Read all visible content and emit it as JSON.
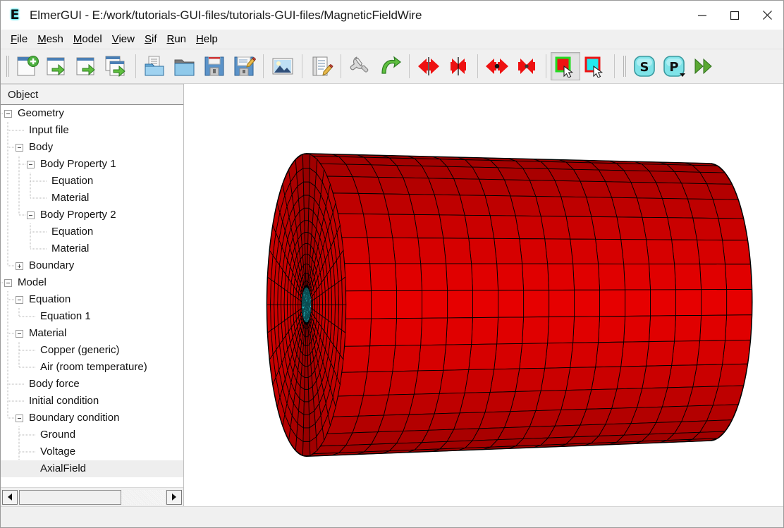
{
  "window": {
    "title": "ElmerGUI - E:/work/tutorials-GUI-files/tutorials-GUI-files/MagneticFieldWire",
    "app_letter": "E",
    "minimize_label": "Minimize",
    "maximize_label": "Maximize",
    "close_label": "Close"
  },
  "menubar": {
    "items": [
      {
        "mnemonic": "F",
        "rest": "ile"
      },
      {
        "mnemonic": "M",
        "rest": "esh"
      },
      {
        "mnemonic": "M",
        "rest": "odel"
      },
      {
        "mnemonic": "V",
        "rest": "iew"
      },
      {
        "mnemonic": "S",
        "rest": "if"
      },
      {
        "mnemonic": "R",
        "rest": "un"
      },
      {
        "mnemonic": "H",
        "rest": "elp"
      }
    ]
  },
  "toolbar": {
    "buttons": [
      {
        "name": "new-project-icon",
        "tip": "New project"
      },
      {
        "name": "open-geometry-icon",
        "tip": "Open geometry"
      },
      {
        "name": "load-mesh-icon",
        "tip": "Load mesh"
      },
      {
        "name": "load-project-icon",
        "tip": "Load project"
      },
      {
        "name": "open-file-icon",
        "tip": "Open file"
      },
      {
        "name": "open-folder-icon",
        "tip": "Open folder"
      },
      {
        "name": "save-icon",
        "tip": "Save"
      },
      {
        "name": "save-as-icon",
        "tip": "Save as"
      },
      {
        "name": "screenshot-icon",
        "tip": "Save picture"
      },
      {
        "name": "edit-sif-icon",
        "tip": "Edit .sif"
      },
      {
        "name": "generate-sif-icon",
        "tip": "Generate sif"
      },
      {
        "name": "run-solver-icon",
        "tip": "Run solver"
      },
      {
        "name": "split-surface-icon",
        "tip": "Divide surface"
      },
      {
        "name": "unify-surface-icon",
        "tip": "Unify surface"
      },
      {
        "name": "split-edge-icon",
        "tip": "Divide edge"
      },
      {
        "name": "unify-edge-icon",
        "tip": "Unify edge"
      },
      {
        "name": "select-surface-icon",
        "tip": "Select surface",
        "pressed": true
      },
      {
        "name": "select-edge-icon",
        "tip": "Select edge"
      },
      {
        "name": "elmer-solver-icon",
        "tip": "Start solver",
        "letter": "S"
      },
      {
        "name": "elmer-post-icon",
        "tip": "Start postprocessor",
        "letter": "P"
      },
      {
        "name": "run-all-icon",
        "tip": "Run"
      }
    ]
  },
  "tree": {
    "header": "Object",
    "nodes": [
      {
        "label": "Geometry",
        "depth": 0,
        "toggle": "minus",
        "selected": false
      },
      {
        "label": "Input file",
        "depth": 1,
        "toggle": "none",
        "selected": false
      },
      {
        "label": "Body",
        "depth": 1,
        "toggle": "minus",
        "selected": false
      },
      {
        "label": "Body Property 1",
        "depth": 2,
        "toggle": "minus",
        "selected": false
      },
      {
        "label": "Equation",
        "depth": 3,
        "toggle": "none",
        "selected": false
      },
      {
        "label": "Material",
        "depth": 3,
        "toggle": "none",
        "selected": false
      },
      {
        "label": "Body Property 2",
        "depth": 2,
        "toggle": "minus",
        "selected": false
      },
      {
        "label": "Equation",
        "depth": 3,
        "toggle": "none",
        "selected": false
      },
      {
        "label": "Material",
        "depth": 3,
        "toggle": "none",
        "selected": false
      },
      {
        "label": "Boundary",
        "depth": 1,
        "toggle": "plus",
        "selected": false
      },
      {
        "label": "Model",
        "depth": 0,
        "toggle": "minus",
        "selected": false
      },
      {
        "label": "Equation",
        "depth": 1,
        "toggle": "minus",
        "selected": false
      },
      {
        "label": "Equation 1",
        "depth": 2,
        "toggle": "none",
        "selected": false
      },
      {
        "label": "Material",
        "depth": 1,
        "toggle": "minus",
        "selected": false
      },
      {
        "label": "Copper (generic)",
        "depth": 2,
        "toggle": "none",
        "selected": false
      },
      {
        "label": "Air (room temperature)",
        "depth": 2,
        "toggle": "none",
        "selected": false
      },
      {
        "label": "Body force",
        "depth": 1,
        "toggle": "none",
        "selected": false
      },
      {
        "label": "Initial condition",
        "depth": 1,
        "toggle": "none",
        "selected": false
      },
      {
        "label": "Boundary condition",
        "depth": 1,
        "toggle": "minus",
        "selected": false
      },
      {
        "label": "Ground",
        "depth": 2,
        "toggle": "none",
        "selected": false
      },
      {
        "label": "Voltage",
        "depth": 2,
        "toggle": "none",
        "selected": false
      },
      {
        "label": "AxialField",
        "depth": 2,
        "toggle": "none",
        "selected": true
      }
    ],
    "scrollbar": {
      "thumb_percent": 70,
      "left_arrow": "◀",
      "right_arrow": "▶"
    }
  },
  "viewport": {
    "background": "#ffffff",
    "mesh_color": "#e60000",
    "mesh_color_dark": "#c00000",
    "mesh_line_color": "#000000",
    "core_color": "#33e0e8",
    "description": "3D meshed cylinder with cyan wire core"
  },
  "statusbar": {
    "text": ""
  }
}
